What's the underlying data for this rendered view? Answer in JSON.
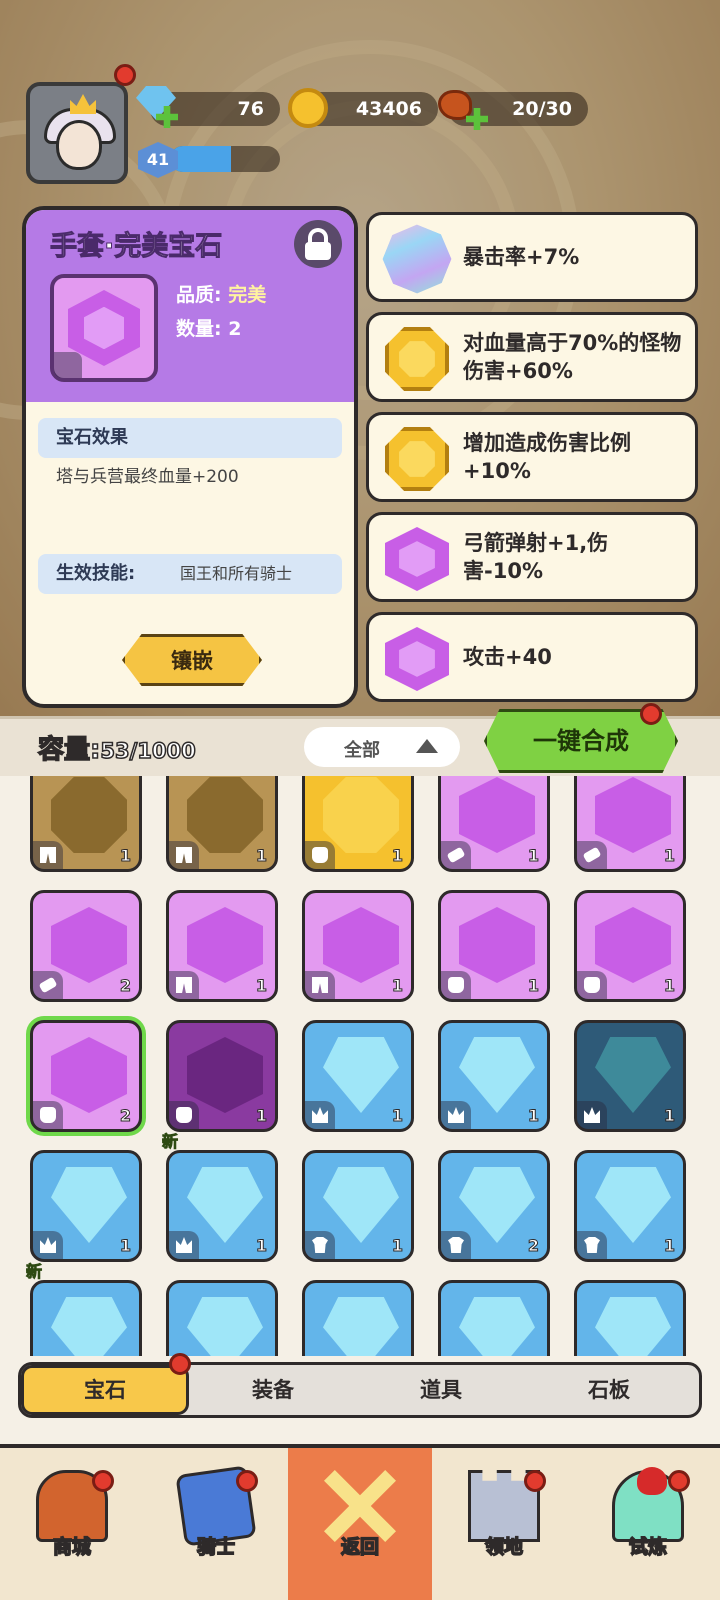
{
  "hud": {
    "gems": "76",
    "gold": "43406",
    "stamina": "20/30",
    "level": "41",
    "xp_fraction": 0.55
  },
  "detail": {
    "title": "手套·完美宝石",
    "quality_label": "品质: ",
    "quality_value": "完美",
    "quantity_label": "数量: ",
    "quantity_value": "2",
    "effect_header": "宝石效果",
    "effect_text": "塔与兵营最终血量+200",
    "skill_label": "生效技能:",
    "skill_value": "国王和所有骑士",
    "inlay_button": "镶嵌",
    "icons": {
      "lock": "unlock-icon",
      "gem": "purple-gem-icon",
      "slot_type": "glove-icon"
    }
  },
  "effects": [
    {
      "text": "暴击率+7%",
      "icon": "rainbow-gem-icon"
    },
    {
      "text": "对血量高于70%的怪物伤害+60%",
      "icon": "gold-gem-icon"
    },
    {
      "text": "增加造成伤害比例+10%",
      "icon": "gold-gem-icon"
    },
    {
      "text": "弓箭弹射+1,伤害-10%",
      "icon": "purple-gem-icon"
    },
    {
      "text": "攻击+40",
      "icon": "purple-gem-icon"
    }
  ],
  "inventory": {
    "capacity_label": "容量:",
    "capacity_value": "53/1000",
    "filter_label": "全部",
    "synthesize_button": "一键合成",
    "new_tag": "新",
    "rows": [
      [
        {
          "color": "bronze",
          "shape": "oct",
          "slot": "pants",
          "count": "1"
        },
        {
          "color": "bronze",
          "shape": "oct",
          "slot": "pants",
          "count": "1"
        },
        {
          "color": "gold",
          "shape": "oct",
          "slot": "glove",
          "count": "1"
        },
        {
          "color": "purple",
          "shape": "hex",
          "slot": "scroll",
          "count": "1"
        },
        {
          "color": "purple",
          "shape": "hex",
          "slot": "scroll",
          "count": "1"
        }
      ],
      [
        {
          "color": "purple",
          "shape": "hex",
          "slot": "scroll",
          "count": "2"
        },
        {
          "color": "purple",
          "shape": "hex",
          "slot": "pants",
          "count": "1"
        },
        {
          "color": "purple",
          "shape": "hex",
          "slot": "pants",
          "count": "1"
        },
        {
          "color": "purple",
          "shape": "hex",
          "slot": "glove",
          "count": "1"
        },
        {
          "color": "purple",
          "shape": "hex",
          "slot": "glove",
          "count": "1"
        }
      ],
      [
        {
          "color": "purple",
          "shape": "hex",
          "slot": "glove",
          "count": "2",
          "selected": true
        },
        {
          "color": "dpurple",
          "shape": "hex",
          "slot": "glove",
          "count": "1"
        },
        {
          "color": "blue",
          "shape": "pent",
          "slot": "crown",
          "count": "1"
        },
        {
          "color": "blue",
          "shape": "pent",
          "slot": "crown",
          "count": "1"
        },
        {
          "color": "dblue",
          "shape": "pent",
          "slot": "crown",
          "count": "1"
        }
      ],
      [
        {
          "color": "blue",
          "shape": "pent",
          "slot": "crown",
          "count": "1"
        },
        {
          "color": "blue",
          "shape": "pent",
          "slot": "crown",
          "count": "1",
          "new": true
        },
        {
          "color": "blue",
          "shape": "pent",
          "slot": "shirt",
          "count": "1"
        },
        {
          "color": "blue",
          "shape": "pent",
          "slot": "shirt",
          "count": "2"
        },
        {
          "color": "blue",
          "shape": "pent",
          "slot": "shirt",
          "count": "1"
        }
      ],
      [
        {
          "color": "blue",
          "shape": "pent",
          "slot": "crown",
          "count": "",
          "new": true
        },
        {
          "color": "blue",
          "shape": "pent",
          "slot": "crown",
          "count": ""
        },
        {
          "color": "blue",
          "shape": "pent",
          "slot": "shirt",
          "count": ""
        },
        {
          "color": "blue",
          "shape": "pent",
          "slot": "shirt",
          "count": ""
        },
        {
          "color": "blue",
          "shape": "pent",
          "slot": "shirt",
          "count": ""
        }
      ]
    ]
  },
  "tabs": [
    "宝石",
    "装备",
    "道具",
    "石板"
  ],
  "nav": [
    {
      "label": "商城",
      "icon": "shop-icon"
    },
    {
      "label": "骑士",
      "icon": "knight-icon"
    },
    {
      "label": "返回",
      "icon": "close-icon"
    },
    {
      "label": "领地",
      "icon": "castle-icon"
    },
    {
      "label": "试炼",
      "icon": "skull-trial-icon"
    }
  ],
  "colors": {
    "accent_green": "#7fd143",
    "accent_gold": "#f8c84a",
    "purple_header": "#b57ae6",
    "notify_red": "#e23b2e"
  }
}
